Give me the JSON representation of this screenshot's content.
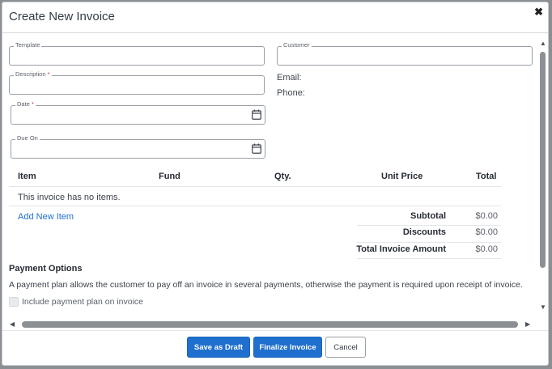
{
  "modal": {
    "title": "Create New Invoice",
    "close_icon": "close-icon",
    "close_glyph": "✖"
  },
  "form": {
    "template": {
      "label": "Template",
      "value": ""
    },
    "customer": {
      "label": "Customer",
      "value": ""
    },
    "description": {
      "label": "Description",
      "required_mark": "*",
      "value": ""
    },
    "date": {
      "label": "Date",
      "required_mark": "*",
      "value": "",
      "icon": "calendar-icon"
    },
    "due_on": {
      "label": "Due On",
      "value": "",
      "icon": "calendar-icon"
    },
    "email_label": "Email:",
    "phone_label": "Phone:"
  },
  "items_table": {
    "headers": [
      "Item",
      "Fund",
      "Qty.",
      "Unit Price",
      "Total"
    ],
    "empty_message": "This invoice has no items.",
    "add_link": "Add New Item"
  },
  "summary": {
    "subtotal_label": "Subtotal",
    "subtotal_value": "$0.00",
    "discounts_label": "Discounts",
    "discounts_value": "$0.00",
    "total_label": "Total Invoice Amount",
    "total_value": "$0.00"
  },
  "payment_options": {
    "title": "Payment Options",
    "description": "A payment plan allows the customer to pay off an invoice in several payments, otherwise the payment is required upon receipt of invoice.",
    "checkbox_label": "Include payment plan on invoice",
    "checkbox_checked": false
  },
  "scrollbars": {
    "up_arrow": "▲",
    "down_arrow": "▼",
    "left_arrow": "◀",
    "right_arrow": "▶"
  },
  "footer": {
    "save_draft": "Save as Draft",
    "finalize": "Finalize Invoice",
    "cancel": "Cancel"
  },
  "colors": {
    "primary": "#1f6fce",
    "required": "#d32f2f",
    "link": "#1f6fce"
  }
}
